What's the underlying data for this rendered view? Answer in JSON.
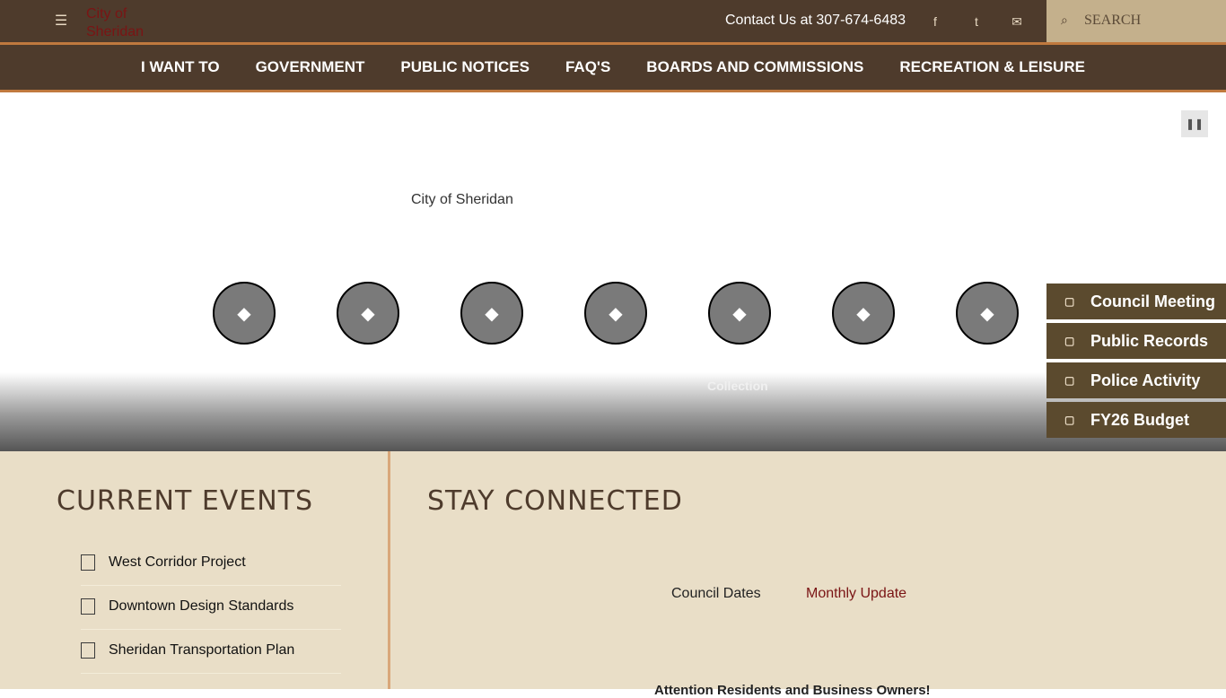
{
  "header": {
    "logo_alt": "City of Sheridan",
    "contact_text": "Contact Us at 307-674-6483",
    "search_placeholder": "SEARCH",
    "icons": [
      "menu-icon",
      "facebook-icon",
      "twitter-icon",
      "email-icon",
      "search-icon"
    ]
  },
  "nav": {
    "items": [
      "I WANT TO",
      "GOVERNMENT",
      "PUBLIC NOTICES",
      "FAQ'S",
      "BOARDS AND COMMISSIONS",
      "RECREATION & LEISURE"
    ]
  },
  "hero": {
    "logo_alt": "City of Sheridan",
    "circle_visible_label": "Collection",
    "pause_icon": "pause-icon"
  },
  "quick_links": {
    "items": [
      "Council Meeting",
      "Public Records",
      "Police Activity",
      "FY26 Budget"
    ]
  },
  "current_events": {
    "title": "CURRENT EVENTS",
    "items": [
      "West Corridor Project",
      "Downtown Design Standards",
      "Sheridan Transportation Plan"
    ]
  },
  "stay_connected": {
    "title": "STAY CONNECTED",
    "council_dates_alt": "Council Dates",
    "monthly_update_alt": "Monthly Update",
    "attention_text": "Attention Residents and Business Owners!"
  },
  "colors": {
    "header_bg": "#4e3b2c",
    "accent_border": "#c0793e",
    "search_bg": "#c4b08c",
    "quick_link_bg": "#5b4a2e",
    "content_bg": "#e9dec7",
    "link_red": "#7a1414"
  }
}
